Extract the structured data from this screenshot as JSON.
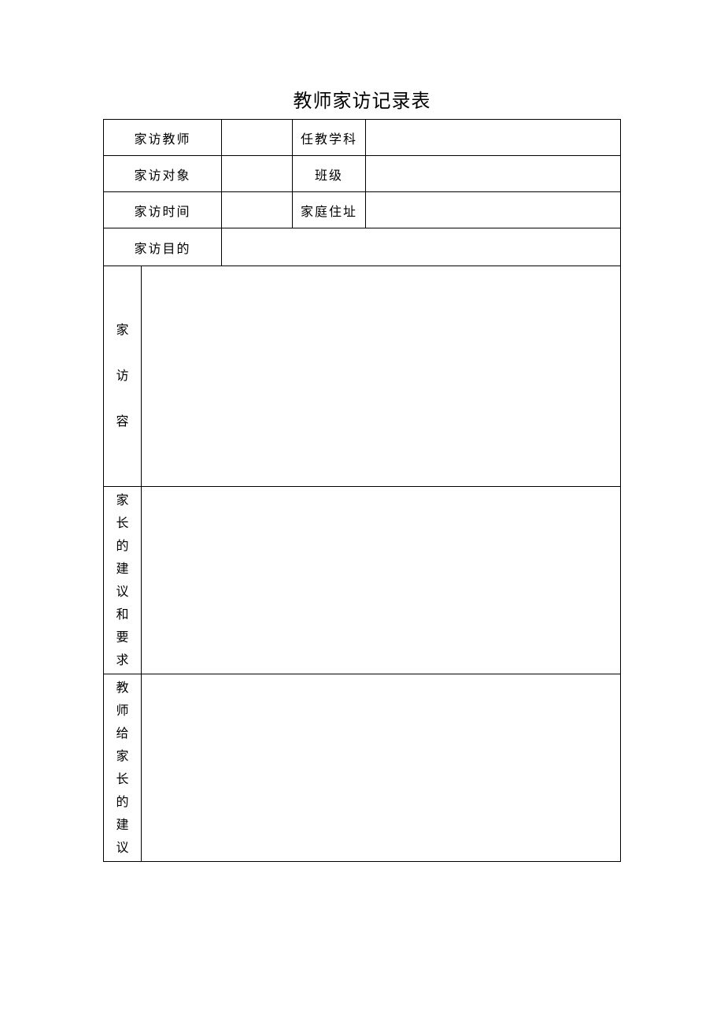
{
  "title": "教师家访记录表",
  "rows": {
    "r1": {
      "label1": "家访教师",
      "value1": "",
      "label2": "任教学科",
      "value2": ""
    },
    "r2": {
      "label1": "家访对象",
      "value1": "",
      "label2": "班级",
      "value2": ""
    },
    "r3": {
      "label1": "家访时间",
      "value1": "",
      "label2": "家庭住址",
      "value2": ""
    },
    "r4": {
      "label1": "家访目的",
      "value1": ""
    }
  },
  "sections": {
    "content": {
      "label": "家访容",
      "value": ""
    },
    "parent_suggest": {
      "label": "家长的建议和要求",
      "value": ""
    },
    "teacher_advice": {
      "label": "教师给家长的建议",
      "value": ""
    }
  }
}
